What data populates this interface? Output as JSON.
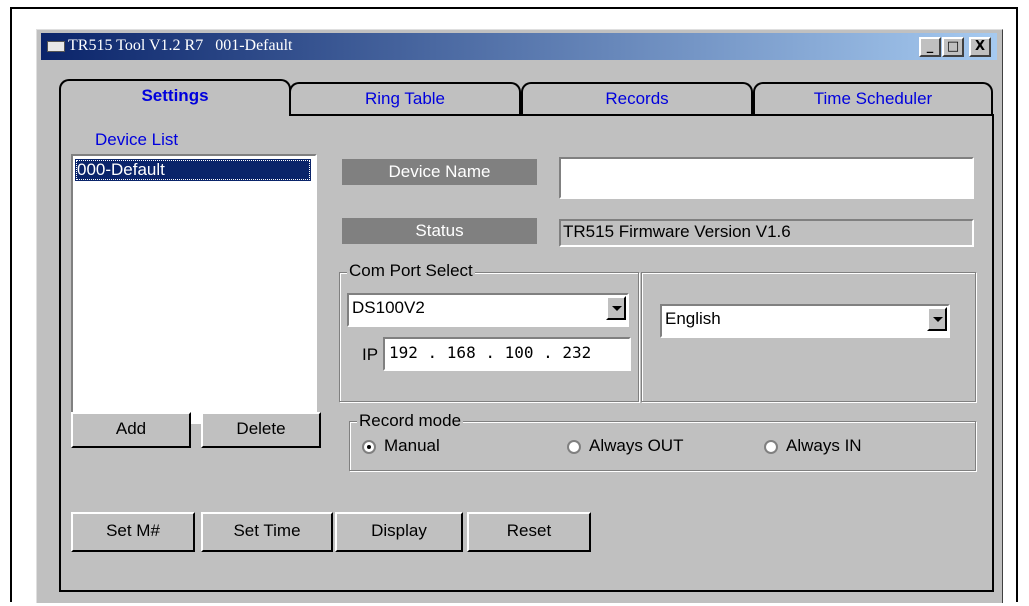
{
  "window": {
    "title": "TR515 Tool V1.2 R7   001-Default",
    "minimize": "_",
    "maximize": "□",
    "close": "X"
  },
  "tabs": [
    {
      "label": "Settings",
      "active": true
    },
    {
      "label": "Ring Table",
      "active": false
    },
    {
      "label": "Records",
      "active": false
    },
    {
      "label": "Time Scheduler",
      "active": false
    }
  ],
  "device_list": {
    "label": "Device List",
    "items": [
      "000-Default"
    ],
    "selected": "000-Default"
  },
  "buttons": {
    "add": "Add",
    "delete": "Delete",
    "set_m": "Set M#",
    "set_time": "Set Time",
    "display": "Display",
    "reset": "Reset"
  },
  "device_name": {
    "label": "Device Name",
    "value": ""
  },
  "status": {
    "label": "Status",
    "value": "TR515 Firmware Version V1.6"
  },
  "com_port": {
    "group_label": "Com Port Select",
    "selected": "DS100V2",
    "ip_label": "IP",
    "ip_value": "192 . 168 . 100 . 232"
  },
  "language": {
    "selected": "English"
  },
  "record_mode": {
    "group_label": "Record mode",
    "options": [
      "Manual",
      "Always OUT",
      "Always IN"
    ],
    "selected": "Manual"
  },
  "colors": {
    "tab_text": "#0000dd",
    "selection": "#0a246a",
    "window_bg": "#c0c0c0"
  }
}
